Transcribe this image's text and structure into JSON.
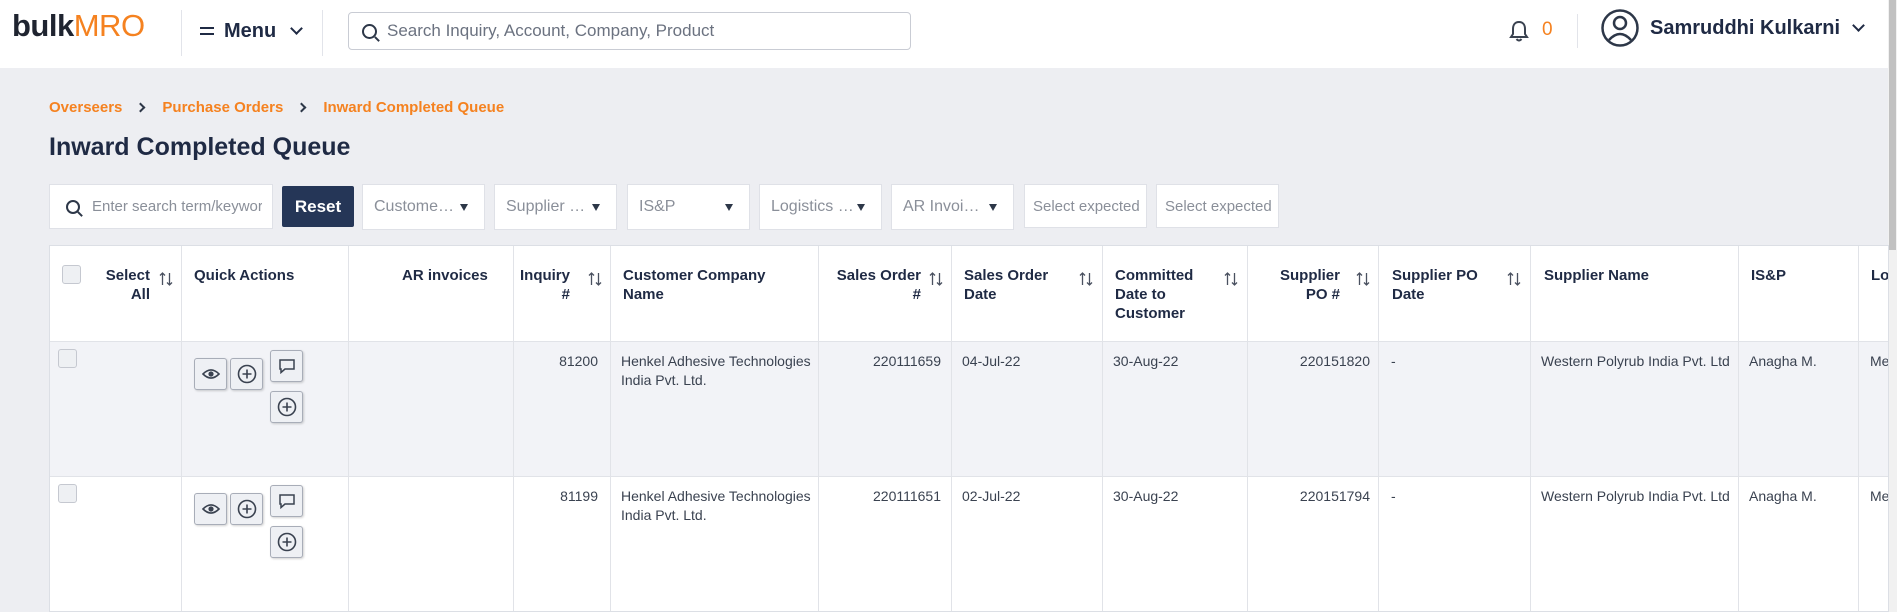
{
  "header": {
    "logo_bulk": "bulk",
    "logo_mro": "MRO",
    "menu_label": "Menu",
    "search_placeholder": "Search Inquiry, Account, Company, Product",
    "notification_count": "0",
    "user_name": "Samruddhi Kulkarni"
  },
  "breadcrumb": [
    "Overseers",
    "Purchase Orders",
    "Inward Completed Queue"
  ],
  "page_title": "Inward Completed Queue",
  "filters": {
    "search_placeholder": "Enter search term/keyword",
    "reset_label": "Reset",
    "dropdowns": [
      "Customer Company",
      "Supplier Name",
      "IS&P",
      "Logistics Owner",
      "AR Invoice Status"
    ],
    "date_placeholders": [
      "Select expected date",
      "Select expected date"
    ]
  },
  "table": {
    "columns": {
      "select_all": "Select All",
      "quick_actions": "Quick Actions",
      "ar_invoices": "AR invoices",
      "inquiry": "Inquiry #",
      "customer_company": "Customer Company Name",
      "sales_order": "Sales Order #",
      "so_date": "Sales Order Date",
      "committed_date": "Committed Date to Customer",
      "supplier_po": "Supplier PO #",
      "supplier_po_date": "Supplier PO Date",
      "supplier_name": "Supplier Name",
      "isp": "IS&P",
      "logistics": "Lo"
    },
    "rows": [
      {
        "inquiry": "81200",
        "customer": "Henkel Adhesive Technologies India Pvt. Ltd.",
        "sales_order": "220111659",
        "so_date": "04-Jul-22",
        "committed_date": "30-Aug-22",
        "supplier_po": "220151820",
        "supplier_po_date": "-",
        "supplier_name": "Western Polyrub India Pvt. Ltd",
        "isp": "Anagha M.",
        "logistics": "Me"
      },
      {
        "inquiry": "81199",
        "customer": "Henkel Adhesive Technologies India Pvt. Ltd.",
        "sales_order": "220111651",
        "so_date": "02-Jul-22",
        "committed_date": "30-Aug-22",
        "supplier_po": "220151794",
        "supplier_po_date": "-",
        "supplier_name": "Western Polyrub India Pvt. Ltd",
        "isp": "Anagha M.",
        "logistics": "Me"
      }
    ]
  },
  "colors": {
    "accent": "#f58220",
    "navy": "#253657",
    "background": "#edeef2",
    "row_highlight": "#f2f3f7"
  },
  "icons": [
    "search-icon",
    "menu-icon",
    "chevron-down-icon",
    "bell-icon",
    "user-avatar-icon",
    "sort-icon",
    "eye-icon",
    "add-circle-icon",
    "comment-icon"
  ]
}
